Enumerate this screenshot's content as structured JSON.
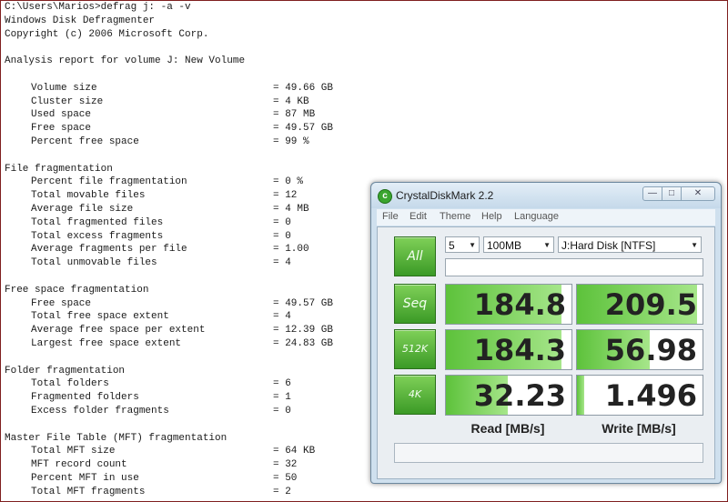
{
  "console": {
    "lines": [
      {
        "text": "C:\\Users\\Marios>defrag j: -a -v"
      },
      {
        "text": "Windows Disk Defragmenter"
      },
      {
        "text": "Copyright (c) 2006 Microsoft Corp."
      },
      {
        "text": ""
      },
      {
        "text": "Analysis report for volume J: New Volume"
      },
      {
        "text": ""
      },
      {
        "label": "Volume size",
        "value": "= 49.66 GB"
      },
      {
        "label": "Cluster size",
        "value": "= 4 KB"
      },
      {
        "label": "Used space",
        "value": "= 87 MB"
      },
      {
        "label": "Free space",
        "value": "= 49.57 GB"
      },
      {
        "label": "Percent free space",
        "value": "= 99 %"
      },
      {
        "text": ""
      },
      {
        "text": "File fragmentation"
      },
      {
        "label": "Percent file fragmentation",
        "value": "= 0 %"
      },
      {
        "label": "Total movable files",
        "value": "= 12"
      },
      {
        "label": "Average file size",
        "value": "= 4 MB"
      },
      {
        "label": "Total fragmented files",
        "value": "= 0"
      },
      {
        "label": "Total excess fragments",
        "value": "= 0"
      },
      {
        "label": "Average fragments per file",
        "value": "= 1.00"
      },
      {
        "label": "Total unmovable files",
        "value": "= 4"
      },
      {
        "text": ""
      },
      {
        "text": "Free space fragmentation"
      },
      {
        "label": "Free space",
        "value": "= 49.57 GB"
      },
      {
        "label": "Total free space extent",
        "value": "= 4"
      },
      {
        "label": "Average free space per extent",
        "value": "= 12.39 GB"
      },
      {
        "label": "Largest free space extent",
        "value": "= 24.83 GB"
      },
      {
        "text": ""
      },
      {
        "text": "Folder fragmentation"
      },
      {
        "label": "Total folders",
        "value": "= 6"
      },
      {
        "label": "Fragmented folders",
        "value": "= 1"
      },
      {
        "label": "Excess folder fragments",
        "value": "= 0"
      },
      {
        "text": ""
      },
      {
        "text": "Master File Table (MFT) fragmentation"
      },
      {
        "label": "Total MFT size",
        "value": "= 64 KB"
      },
      {
        "label": "MFT record count",
        "value": "= 32"
      },
      {
        "label": "Percent MFT in use",
        "value": "= 50"
      },
      {
        "label": "Total MFT fragments",
        "value": "= 2"
      }
    ]
  },
  "cdm": {
    "title": "CrystalDiskMark 2.2",
    "window_buttons": {
      "minimize": "—",
      "maximize": "□",
      "close": "✕"
    },
    "menu": [
      "File",
      "Edit",
      "Theme",
      "Help",
      "Language"
    ],
    "all_label": "All",
    "count_value": "5",
    "size_value": "100MB",
    "drive_value": "J:Hard Disk [NTFS]",
    "tests": [
      {
        "label": "Seq",
        "read": "184.8",
        "write": "209.5",
        "read_fill": 0.92,
        "write_fill": 0.96
      },
      {
        "label": "512K",
        "read": "184.3",
        "write": "56.98",
        "read_fill": 0.92,
        "write_fill": 0.58
      },
      {
        "label": "4K",
        "read": "32.23",
        "write": "1.496",
        "read_fill": 0.49,
        "write_fill": 0.06
      }
    ],
    "read_header": "Read [MB/s]",
    "write_header": "Write [MB/s]",
    "accent": "#4bb02f"
  }
}
